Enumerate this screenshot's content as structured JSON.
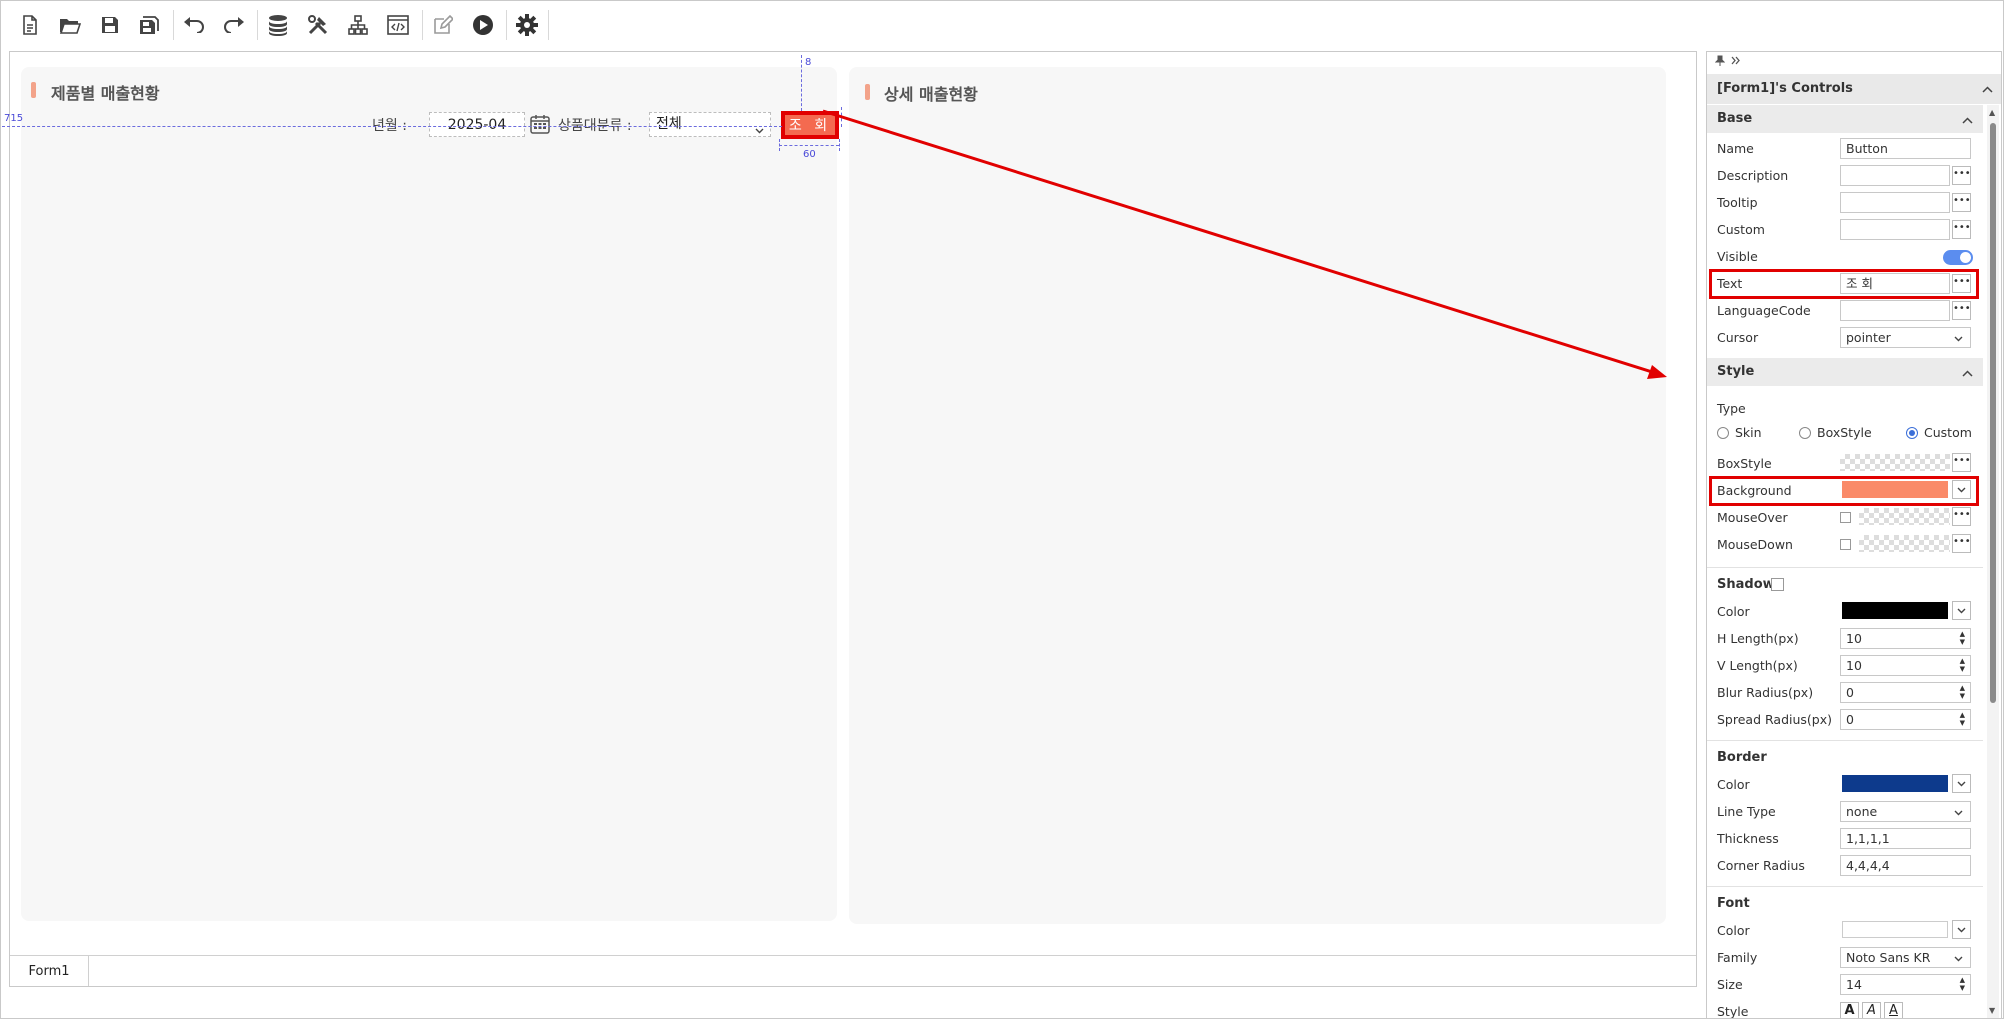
{
  "toolbar": {
    "buttons": [
      "new-file-icon",
      "open-folder-icon",
      "save-icon",
      "save-all-icon",
      "undo-icon",
      "redo-icon",
      "database-icon",
      "tools-icon",
      "hierarchy-icon",
      "code-view-icon",
      "edit-icon",
      "run-icon",
      "settings-icon"
    ]
  },
  "canvas": {
    "left_panel": {
      "title": "제품별 매출현황",
      "month_label": "년월 :",
      "month_value": "2025-04",
      "category_label": "상품대분류 :",
      "category_value": "전체",
      "search_button": "조 회"
    },
    "right_panel": {
      "title": "상세 매출현황"
    },
    "guides": {
      "top": "8",
      "left": "715",
      "width": "60"
    },
    "form_tab": "Form1"
  },
  "properties": {
    "header": "[Form1]'s Controls",
    "base": {
      "title": "Base",
      "name_label": "Name",
      "name_value": "Button",
      "description_label": "Description",
      "tooltip_label": "Tooltip",
      "custom_label": "Custom",
      "visible_label": "Visible",
      "text_label": "Text",
      "text_value": "조 회",
      "language_label": "LanguageCode",
      "cursor_label": "Cursor",
      "cursor_value": "pointer"
    },
    "style": {
      "title": "Style",
      "type_label": "Type",
      "type_options": [
        "Skin",
        "BoxStyle",
        "Custom"
      ],
      "boxstyle_label": "BoxStyle",
      "background_label": "Background",
      "background_color": "#fa8a68",
      "mouseover_label": "MouseOver",
      "mousedown_label": "MouseDown"
    },
    "shadow": {
      "title": "Shadow",
      "color_label": "Color",
      "color": "#000000",
      "h_label": "H Length(px)",
      "h_value": "10",
      "v_label": "V Length(px)",
      "v_value": "10",
      "blur_label": "Blur Radius(px)",
      "blur_value": "0",
      "spread_label": "Spread Radius(px)",
      "spread_value": "0"
    },
    "border": {
      "title": "Border",
      "color_label": "Color",
      "color": "#0d3a8c",
      "linetype_label": "Line Type",
      "linetype_value": "none",
      "thickness_label": "Thickness",
      "thickness_value": "1,1,1,1",
      "radius_label": "Corner Radius",
      "radius_value": "4,4,4,4"
    },
    "font": {
      "title": "Font",
      "color_label": "Color",
      "family_label": "Family",
      "family_value": "Noto Sans KR",
      "size_label": "Size",
      "size_value": "14",
      "style_label": "Style",
      "style_glyph": "A"
    }
  }
}
